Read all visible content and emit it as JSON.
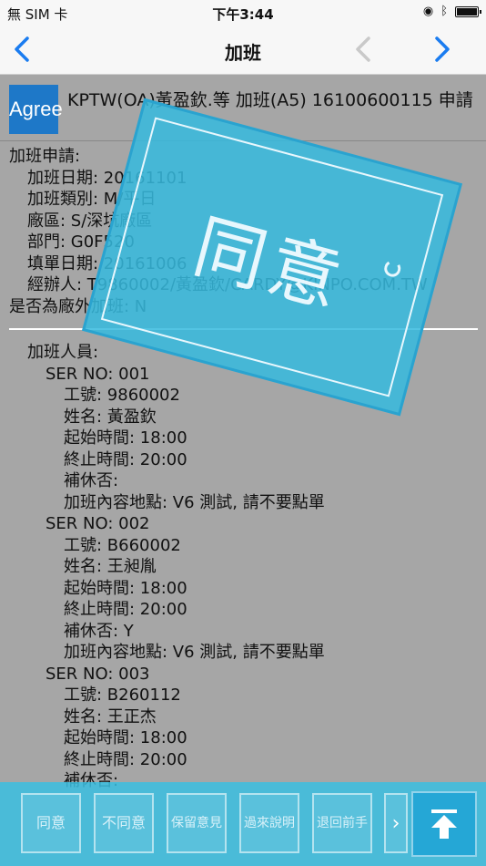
{
  "status_bar": {
    "carrier": "無 SIM 卡",
    "time": "下午3:44"
  },
  "nav": {
    "title": "加班"
  },
  "header": {
    "logo_text": "Agree",
    "subject": "KPTW(OA)黃盈欽.等 加班(A5) 16100600115 申請"
  },
  "form": {
    "heading": "加班申請:",
    "fields": [
      "加班日期: 20161101",
      "加班類別: M/平日",
      "廠區: S/深坑廠區",
      "部門: G0F520",
      "填單日期: 20161006",
      "經辦人: T9860002/黃盈欽/CARDY@KINPO.COM.TW"
    ],
    "offsite": "是否為廠外加班: N"
  },
  "staff": {
    "heading": "加班人員:",
    "records": [
      {
        "ser": "SER NO: 001",
        "lines": [
          "工號: 9860002",
          "姓名: 黃盈欽",
          "起始時間: 18:00",
          "終止時間: 20:00",
          "補休否:",
          "加班內容地點: V6 測試, 請不要點單"
        ]
      },
      {
        "ser": "SER NO: 002",
        "lines": [
          "工號: B660002",
          "姓名: 王昶胤",
          "起始時間: 18:00",
          "終止時間: 20:00",
          "補休否: Y",
          "加班內容地點: V6 測試, 請不要點單"
        ]
      },
      {
        "ser": "SER NO: 003",
        "lines": [
          "工號: B260112",
          "姓名: 王正杰",
          "起始時間: 18:00",
          "終止時間: 20:00",
          "補休否:"
        ]
      }
    ]
  },
  "stamp": {
    "text": "同意"
  },
  "toolbar": {
    "agree": "同意",
    "disagree": "不同意",
    "reserve": "保留意見",
    "explain": "過來說明",
    "return": "退回前手"
  }
}
